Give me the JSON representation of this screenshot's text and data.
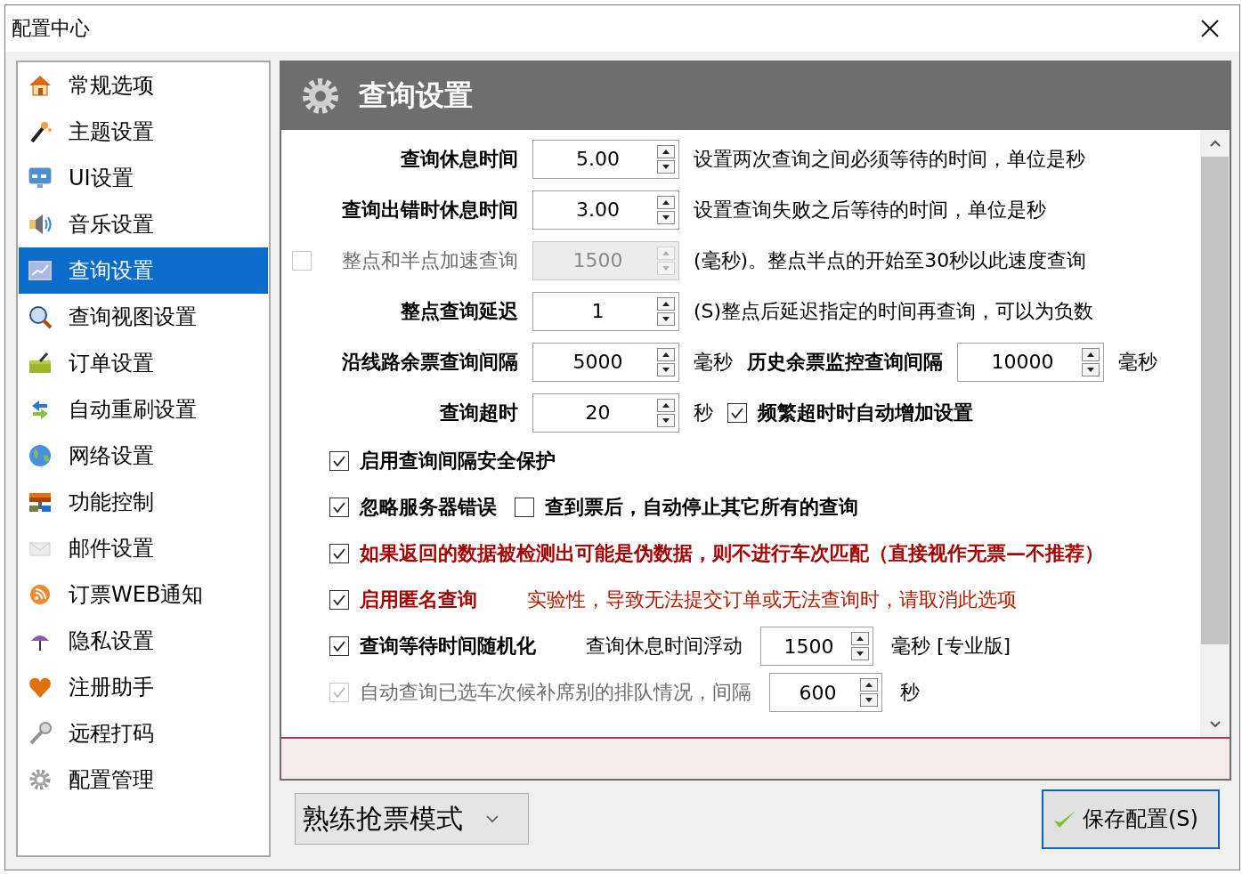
{
  "window": {
    "title": "配置中心"
  },
  "sidebar": {
    "items": [
      {
        "label": "常规选项",
        "selected": false
      },
      {
        "label": "主题设置",
        "selected": false
      },
      {
        "label": "UI设置",
        "selected": false
      },
      {
        "label": "音乐设置",
        "selected": false
      },
      {
        "label": "查询设置",
        "selected": true
      },
      {
        "label": "查询视图设置",
        "selected": false
      },
      {
        "label": "订单设置",
        "selected": false
      },
      {
        "label": "自动重刷设置",
        "selected": false
      },
      {
        "label": "网络设置",
        "selected": false
      },
      {
        "label": "功能控制",
        "selected": false
      },
      {
        "label": "邮件设置",
        "selected": false
      },
      {
        "label": "订票WEB通知",
        "selected": false
      },
      {
        "label": "隐私设置",
        "selected": false
      },
      {
        "label": "注册助手",
        "selected": false
      },
      {
        "label": "远程打码",
        "selected": false
      },
      {
        "label": "配置管理",
        "selected": false
      }
    ]
  },
  "panel": {
    "title": "查询设置",
    "rows": [
      {
        "kind": "field",
        "label": "查询休息时间",
        "spin": {
          "value": "5.00"
        },
        "after": [
          {
            "kind": "text",
            "text": "设置两次查询之间必须等待的时间，单位是秒"
          }
        ]
      },
      {
        "kind": "field",
        "label": "查询出错时休息时间",
        "spin": {
          "value": "3.00"
        },
        "after": [
          {
            "kind": "text",
            "text": "设置查询失败之后等待的时间，单位是秒"
          }
        ]
      },
      {
        "kind": "field",
        "label": "整点和半点加速查询",
        "checked": false,
        "disabled": true,
        "spin": {
          "value": "1500",
          "disabled": true
        },
        "after": [
          {
            "kind": "text",
            "text": "(毫秒)。整点半点的开始至30秒以此速度查询"
          }
        ]
      },
      {
        "kind": "field",
        "label": "整点查询延迟",
        "spin": {
          "value": "1"
        },
        "after": [
          {
            "kind": "text",
            "text": "(S)整点后延迟指定的时间再查询，可以为负数"
          }
        ]
      },
      {
        "kind": "field",
        "label": "沿线路余票查询间隔",
        "spin": {
          "value": "5000"
        },
        "after": [
          {
            "kind": "text",
            "text": "毫秒"
          },
          {
            "kind": "text",
            "text": "历史余票监控查询间隔",
            "bold": true
          },
          {
            "kind": "spin",
            "value": "10000"
          },
          {
            "kind": "text",
            "text": "毫秒"
          }
        ]
      },
      {
        "kind": "field",
        "label": "查询超时",
        "spin": {
          "value": "20"
        },
        "after": [
          {
            "kind": "text",
            "text": "秒"
          },
          {
            "kind": "check",
            "label": "频繁超时时自动增加设置",
            "checked": true,
            "bold": true
          }
        ]
      },
      {
        "kind": "options",
        "parts": [
          {
            "kind": "check",
            "label": "启用查询间隔安全保护",
            "checked": true,
            "bold": true
          }
        ]
      },
      {
        "kind": "options",
        "parts": [
          {
            "kind": "check",
            "label": "忽略服务器错误",
            "checked": true,
            "bold": true
          },
          {
            "kind": "check",
            "label": "查到票后，自动停止其它所有的查询",
            "checked": false,
            "bold": true
          }
        ]
      },
      {
        "kind": "options",
        "parts": [
          {
            "kind": "check",
            "label": "如果返回的数据被检测出可能是伪数据，则不进行车次匹配（直接视作无票—不推荐）",
            "checked": true,
            "bold": true,
            "warning": true
          }
        ]
      },
      {
        "kind": "options",
        "parts": [
          {
            "kind": "check",
            "label": "启用匿名查询",
            "checked": true,
            "bold": true,
            "warning": true
          },
          {
            "kind": "text",
            "text": "实验性，导致无法提交订单或无法查询时，请取消此选项",
            "warning": true
          }
        ]
      },
      {
        "kind": "options",
        "parts": [
          {
            "kind": "check",
            "label": "查询等待时间随机化",
            "checked": true,
            "bold": true
          },
          {
            "kind": "text",
            "text": "查询休息时间浮动"
          },
          {
            "kind": "spin",
            "value": "1500"
          },
          {
            "kind": "text",
            "text": "毫秒 [专业版]"
          }
        ]
      },
      {
        "kind": "options",
        "parts": [
          {
            "kind": "check",
            "label": "自动查询已选车次候补席别的排队情况，间隔",
            "checked": true,
            "disabled": true
          },
          {
            "kind": "spin",
            "value": "600"
          },
          {
            "kind": "text",
            "text": "秒"
          }
        ]
      }
    ]
  },
  "footer": {
    "mode": "熟练抢票模式",
    "save_button": "保存配置(S)"
  }
}
